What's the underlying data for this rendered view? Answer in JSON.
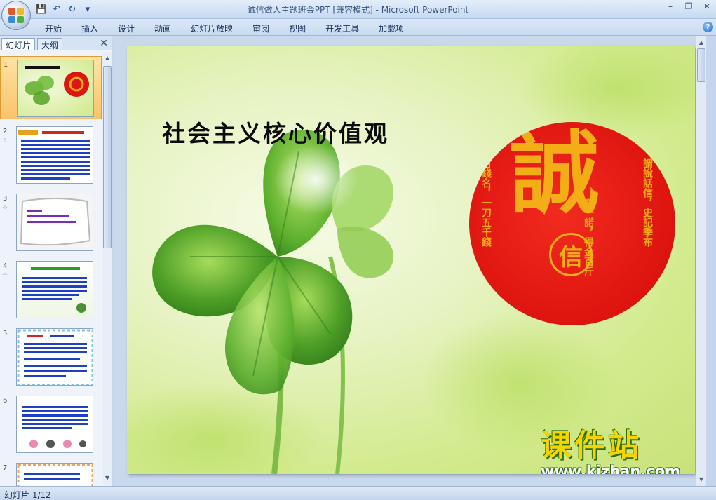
{
  "window": {
    "title": "诚信做人主题班会PPT [兼容模式] - Microsoft PowerPoint",
    "controls": [
      "–",
      "❐",
      "✕"
    ]
  },
  "quick_access": {
    "icons": [
      "save-icon",
      "undo-icon",
      "redo-icon",
      "customize-icon"
    ],
    "glyphs": [
      "💾",
      "↶",
      "↻",
      "▾"
    ]
  },
  "ribbon": {
    "tabs": [
      "开始",
      "插入",
      "设计",
      "动画",
      "幻灯片放映",
      "审阅",
      "视图",
      "开发工具",
      "加载项"
    ],
    "help_glyph": "?"
  },
  "left_pane": {
    "tabs": [
      "幻灯片",
      "大纲"
    ],
    "close_glyph": "✕",
    "slides": [
      {
        "num": "1",
        "anim": ""
      },
      {
        "num": "2",
        "anim": "☆"
      },
      {
        "num": "3",
        "anim": "☆"
      },
      {
        "num": "4",
        "anim": "☆"
      },
      {
        "num": "5",
        "anim": ""
      },
      {
        "num": "6",
        "anim": ""
      },
      {
        "num": "7",
        "anim": ""
      }
    ]
  },
  "slide": {
    "title": "社会主义核心价值观",
    "seal_big": "誠",
    "seal_small": "信",
    "seal_left_col": "古錢名，一刀五千錢",
    "seal_right_col": "謂說話信，史記季布",
    "seal_mid_col": "布一諾，得金百斤"
  },
  "watermark": {
    "main": "课件站",
    "url": "www.kjzhan.com"
  },
  "status": {
    "slide_counter": "幻灯片 1/12"
  },
  "colors": {
    "accent_selected": "#f8c46a",
    "seal_red": "#dd140f",
    "seal_gold": "#f3ad16"
  }
}
